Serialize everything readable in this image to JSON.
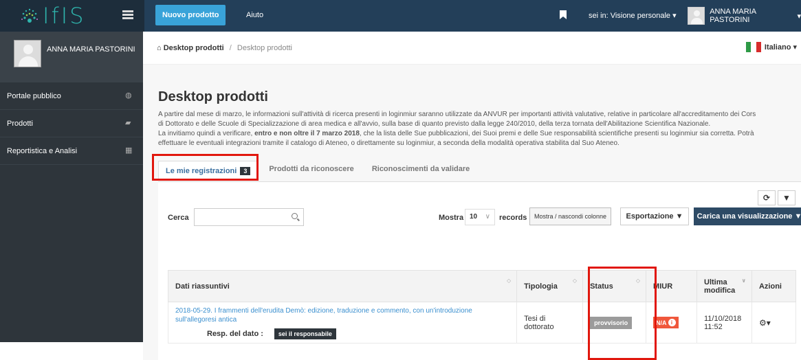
{
  "app": {
    "logo_text": "IfIS",
    "new_product": "Nuovo prodotto",
    "help": "Aiuto",
    "perspective": "sei in: Visione personale",
    "user_name": "ANNA MARIA PASTORINI"
  },
  "sidebar": {
    "user_name": "ANNA MARIA PASTORINI",
    "items": [
      {
        "label": "Portale pubblico",
        "icon": "globe-icon",
        "glyph": "◍"
      },
      {
        "label": "Prodotti",
        "icon": "book-icon",
        "glyph": "▰"
      },
      {
        "label": "Reportistica e Analisi",
        "icon": "table-icon",
        "glyph": "▦"
      }
    ]
  },
  "breadcrumb": {
    "home": "Desktop prodotti",
    "current": "Desktop prodotti"
  },
  "language": "Italiano",
  "page": {
    "title": "Desktop prodotti",
    "intro_1": "A partire dal mese di marzo, le informazioni sull'attività di ricerca presenti in loginmiur saranno utilizzate da ANVUR per importanti attività valutative, relative in particolare all'accreditamento dei Cors",
    "intro_2": "di Dottorato e delle Scuole di Specializzazione di area medica e all'avvio, sulla base di quanto previsto dalla legge 240/2010, della terza tornata dell'Abilitazione Scientifica Nazionale.",
    "intro_3a": "La invitiamo quindi a verificare, ",
    "intro_3b": "entro e non oltre il 7 marzo 2018",
    "intro_3c": ", che la lista delle Sue pubblicazioni, dei Suoi premi e delle Sue responsabilità scientifiche presenti su loginmiur sia corretta. Potrà",
    "intro_4": "effettuare le eventuali integrazioni tramite il catalogo di Ateneo, o direttamente su loginmiur, a seconda della modalità operativa stabilita dal Suo Ateneo."
  },
  "tabs": [
    {
      "label": "Le mie registrazioni",
      "badge": "3"
    },
    {
      "label": "Prodotti da riconoscere"
    },
    {
      "label": "Riconoscimenti da validare"
    }
  ],
  "toolbar": {
    "search_label": "Cerca",
    "search_placeholder": "",
    "show_label": "Mostra",
    "records_value": "10",
    "records_label": "records",
    "columns_button": "Mostra / nascondi colonne",
    "export_button": "Esportazione ▼",
    "load_view_button": "Carica una visualizzazione ▼"
  },
  "table": {
    "headers": [
      "Dati riassuntivi",
      "Tipologia",
      "Status",
      "MIUR",
      "Ultima modifica",
      "Azioni"
    ],
    "rows": [
      {
        "title": "2018-05-29. I frammenti dell'erudita Demò: edizione, traduzione e commento, con un'introduzione sull'allegoresi antica",
        "resp_label": "Resp. del dato :",
        "resp_value": "sei il responsabile",
        "tipologia": "Tesi di dottorato",
        "status": "provvisorio",
        "miur": "N/A",
        "modified_date": "11/10/2018",
        "modified_time": "11:52"
      }
    ]
  },
  "colors": {
    "accent": "#39a3d9",
    "topbar": "#233f59",
    "sidebar": "#2e353b",
    "highlight": "#e1170d"
  }
}
